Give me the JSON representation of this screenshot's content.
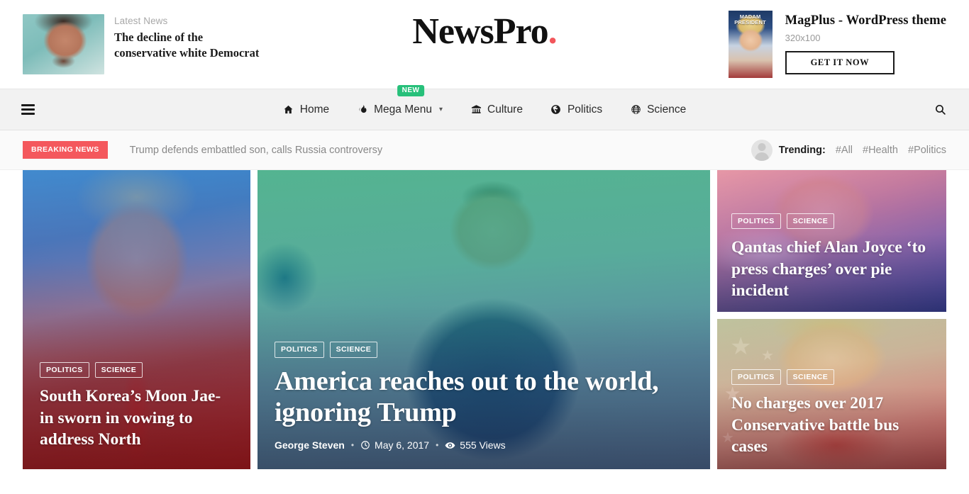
{
  "header": {
    "latest": {
      "label": "Latest News",
      "title": "The decline of the conservative white Democrat",
      "thumb_icon": "portrait-thumbnail"
    },
    "logo": {
      "text": "NewsPro",
      "dot": ".",
      "accent": "#f2565b"
    },
    "ad": {
      "caption": "MADAM PRESIDENT",
      "title": "MagPlus - WordPress theme",
      "size": "320x100",
      "button": "GET IT NOW"
    }
  },
  "nav": {
    "menu_icon": "hamburger-icon",
    "search_icon": "search-icon",
    "items": [
      {
        "label": "Home",
        "icon": "home-icon",
        "badge": null,
        "caret": false
      },
      {
        "label": "Mega Menu",
        "icon": "flame-icon",
        "badge": "NEW",
        "caret": true
      },
      {
        "label": "Culture",
        "icon": "museum-icon",
        "badge": null,
        "caret": false
      },
      {
        "label": "Politics",
        "icon": "globe-americas-icon",
        "badge": null,
        "caret": false
      },
      {
        "label": "Science",
        "icon": "globe-network-icon",
        "badge": null,
        "caret": false
      }
    ]
  },
  "breaking": {
    "tag": "BREAKING NEWS",
    "tag_color": "#f4585d",
    "headline": "Trump defends embattled son, calls Russia controversy",
    "trending_label": "Trending:",
    "trending_tags": [
      "#All",
      "#Health",
      "#Politics"
    ],
    "avatar_icon": "user-avatar-icon"
  },
  "hero": {
    "left": {
      "categories": [
        "POLITICS",
        "SCIENCE"
      ],
      "title": "South Korea’s Moon Jae-in sworn in vowing to address North"
    },
    "main": {
      "categories": [
        "POLITICS",
        "SCIENCE"
      ],
      "title": "America reaches out to the world, ignoring Trump",
      "author": "George Steven",
      "date": "May 6, 2017",
      "views": "555 Views",
      "clock_icon": "clock-icon",
      "eye_icon": "eye-icon"
    },
    "right_top": {
      "categories": [
        "POLITICS",
        "SCIENCE"
      ],
      "title": "Qantas chief Alan Joyce ‘to press charges’ over pie incident"
    },
    "right_bottom": {
      "categories": [
        "POLITICS",
        "SCIENCE"
      ],
      "title": "No charges over 2017 Conservative battle bus cases"
    }
  }
}
